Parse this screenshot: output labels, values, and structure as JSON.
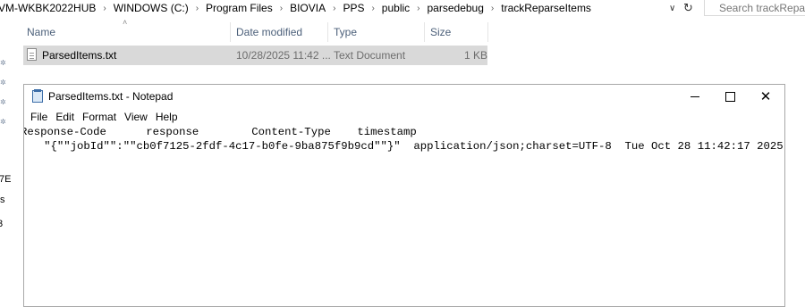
{
  "explorer": {
    "breadcrumb": [
      "VM-WKBK2022HUB",
      "WINDOWS (C:)",
      "Program Files",
      "BIOVIA",
      "PPS",
      "public",
      "parsedebug",
      "trackReparseItems"
    ],
    "search_placeholder": "Search trackReparseItems",
    "columns": {
      "name": "Name",
      "date_modified": "Date modified",
      "type": "Type",
      "size": "Size"
    },
    "files": [
      {
        "name": "ParsedItems.txt",
        "date_modified": "10/28/2025 11:42 ...",
        "type": "Text Document",
        "size": "1 KB"
      }
    ],
    "nav_fragments": [
      "7E",
      "s",
      "3"
    ]
  },
  "notepad": {
    "title": "ParsedItems.txt - Notepad",
    "menu": [
      "File",
      "Edit",
      "Format",
      "View",
      "Help"
    ],
    "header_line": "Response-Code      response        Content-Type    timestamp",
    "data_line": "   \"{\"\"jobId\"\":\"\"cb0f7125-2fdf-4c17-b0fe-9ba875f9b9cd\"\"}\"  application/json;charset=UTF-8  Tue Oct 28 11:42:17 2025"
  }
}
